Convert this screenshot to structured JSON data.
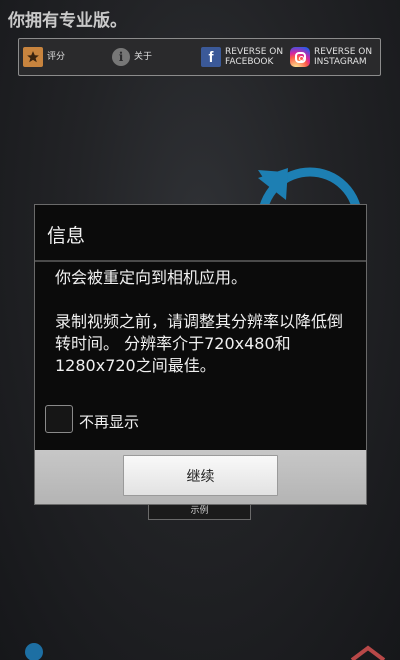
{
  "banner": {
    "text": "你拥有专业版。"
  },
  "toolbar": {
    "rate_label": "评分",
    "about_label": "关于",
    "facebook_label_line1": "REVERSE ON",
    "facebook_label_line2": "FACEBOOK",
    "instagram_label_line1": "REVERSE ON",
    "instagram_label_line2": "INSTAGRAM"
  },
  "icons": {
    "rate": "star-icon",
    "about": "info-icon",
    "facebook": "facebook-icon",
    "instagram": "instagram-icon"
  },
  "colors": {
    "accent_blue": "#1d7fb3",
    "facebook_blue": "#3b5998",
    "star_orange": "#c8843e"
  },
  "dialog": {
    "title": "信息",
    "message": "你会被重定向到相机应用。\n\n录制视频之前，请调整其分辨率以降低倒转时间。 分辨率介于720x480和1280x720之间最佳。",
    "checkbox_label": "不再显示",
    "checkbox_checked": false,
    "continue_label": "继续"
  },
  "background": {
    "example_label": "示例"
  }
}
